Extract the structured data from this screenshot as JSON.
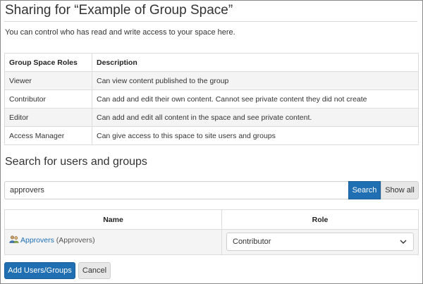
{
  "page": {
    "title": "Sharing for “Example of Group Space”",
    "intro": "You can control who has read and write access to your space here."
  },
  "roles_table": {
    "headers": [
      "Group Space Roles",
      "Description"
    ],
    "rows": [
      {
        "role": "Viewer",
        "description": "Can view content published to the group"
      },
      {
        "role": "Contributor",
        "description": "Can add and edit their own content. Cannot see private content they did not create"
      },
      {
        "role": "Editor",
        "description": "Can add and edit all content in the space and see private content."
      },
      {
        "role": "Access Manager",
        "description": "Can give access to this space to site users and groups"
      }
    ]
  },
  "search": {
    "heading": "Search for users and groups",
    "value": "approvers",
    "search_label": "Search",
    "show_all_label": "Show all"
  },
  "results_table": {
    "headers": [
      "Name",
      "Role"
    ],
    "rows": [
      {
        "name": "Approvers",
        "extra": "(Approvers)",
        "icon": "users-icon",
        "role": "Contributor"
      }
    ]
  },
  "actions": {
    "add_label": "Add Users/Groups",
    "cancel_label": "Cancel"
  },
  "colors": {
    "primary": "#1f6fb2",
    "link": "#1f6fb2",
    "secondary_button": "#e7e7e7",
    "row_stripe": "#f4f4f4"
  }
}
